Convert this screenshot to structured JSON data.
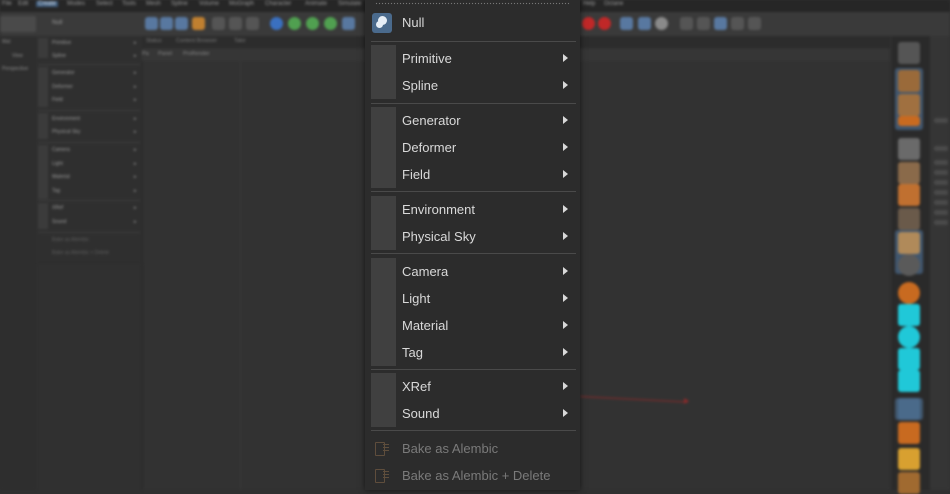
{
  "background": {
    "menubar": [
      "File",
      "Edit",
      "Create",
      "Modes",
      "Select",
      "Tools",
      "Mesh",
      "Spline",
      "Volume",
      "MoGraph",
      "Character",
      "Animate",
      "Simulate"
    ],
    "menubar_right": [
      "Help",
      "Octane"
    ],
    "active_menu": "Create",
    "toolbar_field": "Null",
    "left_panel": [
      "Mat",
      "View",
      "Perspective"
    ],
    "viewport_tabs": [
      "Status",
      "Content Browser",
      "Take"
    ],
    "viewport_header": [
      "Pa",
      "Panel",
      "ProRender"
    ],
    "mini_menu": {
      "items": [
        "Primitive",
        "Spline",
        "Generator",
        "Deformer",
        "Field",
        "Environment",
        "Physical Sky",
        "Camera",
        "Light",
        "Material",
        "Tag",
        "XRef",
        "Sound",
        "Bake as Alembic",
        "Bake as Alembic + Delete"
      ]
    },
    "colors": {
      "accent_blue": "#4a6a8c",
      "axis_red": "#8a2a2a",
      "cyan_icon": "#20c8d8",
      "orange_icon": "#c86a20"
    }
  },
  "menu": {
    "groups": [
      {
        "items": [
          {
            "label": "Null",
            "icon": "null-icon",
            "submenu": false
          }
        ]
      },
      {
        "items": [
          {
            "label": "Primitive",
            "submenu": true
          },
          {
            "label": "Spline",
            "submenu": true
          }
        ]
      },
      {
        "items": [
          {
            "label": "Generator",
            "submenu": true
          },
          {
            "label": "Deformer",
            "submenu": true
          },
          {
            "label": "Field",
            "submenu": true
          }
        ]
      },
      {
        "items": [
          {
            "label": "Environment",
            "submenu": true
          },
          {
            "label": "Physical Sky",
            "submenu": true
          }
        ]
      },
      {
        "items": [
          {
            "label": "Camera",
            "submenu": true
          },
          {
            "label": "Light",
            "submenu": true
          },
          {
            "label": "Material",
            "submenu": true
          },
          {
            "label": "Tag",
            "submenu": true
          }
        ]
      },
      {
        "items": [
          {
            "label": "XRef",
            "submenu": true
          },
          {
            "label": "Sound",
            "submenu": true
          }
        ]
      },
      {
        "items": [
          {
            "label": "Bake as Alembic",
            "icon": "alembic-icon",
            "disabled": true
          },
          {
            "label": "Bake as Alembic + Delete",
            "icon": "alembic-icon",
            "disabled": true
          }
        ]
      }
    ]
  }
}
